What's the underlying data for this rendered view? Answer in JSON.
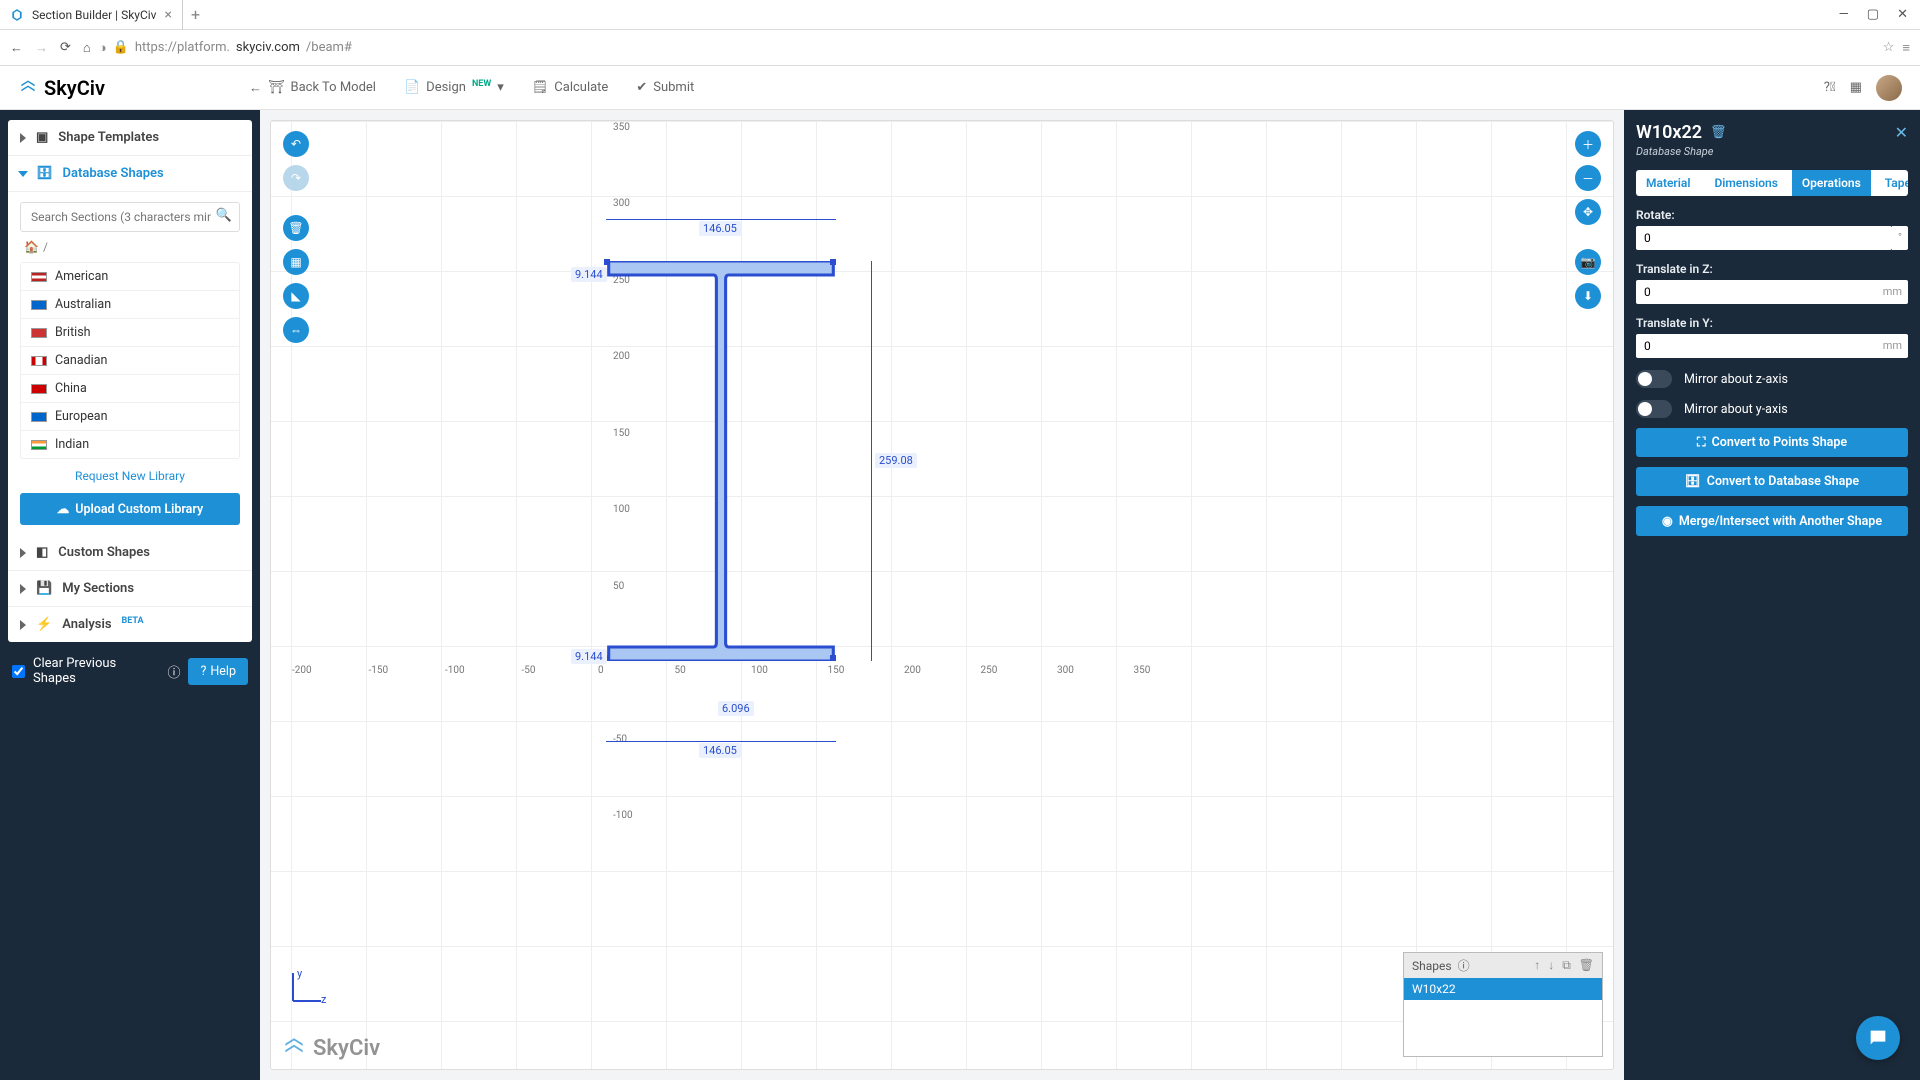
{
  "browser": {
    "tab_title": "Section Builder | SkyCiv",
    "url_display": {
      "prefix": "https://platform.",
      "host": "skyciv.com",
      "rest": "/beam#"
    }
  },
  "topbar": {
    "brand": "SkyCiv",
    "menu": {
      "back": "Back To Model",
      "design": "Design",
      "design_badge": "NEW",
      "calculate": "Calculate",
      "submit": "Submit"
    }
  },
  "left": {
    "sections": {
      "shape_templates": "Shape Templates",
      "database_shapes": "Database Shapes",
      "custom_shapes": "Custom Shapes",
      "my_sections": "My Sections",
      "analysis": "Analysis",
      "analysis_badge": "BETA"
    },
    "search_placeholder": "Search Sections (3 characters min)",
    "libraries": [
      "American",
      "Australian",
      "British",
      "Canadian",
      "China",
      "European",
      "Indian"
    ],
    "request_link": "Request New Library",
    "upload_btn": "Upload Custom Library",
    "clear_label": "Clear Previous Shapes",
    "help_btn": "Help"
  },
  "canvas": {
    "x_ticks": [
      "-200",
      "-150",
      "-100",
      "-50",
      "0",
      "50",
      "100",
      "150",
      "200",
      "250",
      "300",
      "350"
    ],
    "y_ticks": [
      "350",
      "300",
      "250",
      "200",
      "150",
      "100",
      "50",
      "-50",
      "-100"
    ],
    "dims": {
      "width_top": "146.05",
      "width_bot": "146.05",
      "flange": "9.144",
      "web": "6.096",
      "height": "259.08"
    },
    "watermark": "SkyCiv",
    "axes": {
      "v": "y",
      "h": "z"
    },
    "shapes_panel": {
      "title": "Shapes",
      "items": [
        "W10x22"
      ]
    }
  },
  "right": {
    "title": "W10x22",
    "subtitle": "Database Shape",
    "tabs": [
      "Material",
      "Dimensions",
      "Operations",
      "Taper"
    ],
    "active_tab": "Operations",
    "form": {
      "rotate_label": "Rotate:",
      "rotate_value": "0",
      "tz_label": "Translate in Z:",
      "tz_value": "0",
      "ty_label": "Translate in Y:",
      "ty_value": "0",
      "unit": "mm",
      "mirror_z": "Mirror about z-axis",
      "mirror_y": "Mirror about y-axis",
      "btn_points": "Convert to Points Shape",
      "btn_db": "Convert to Database Shape",
      "btn_merge": "Merge/Intersect with Another Shape"
    }
  }
}
